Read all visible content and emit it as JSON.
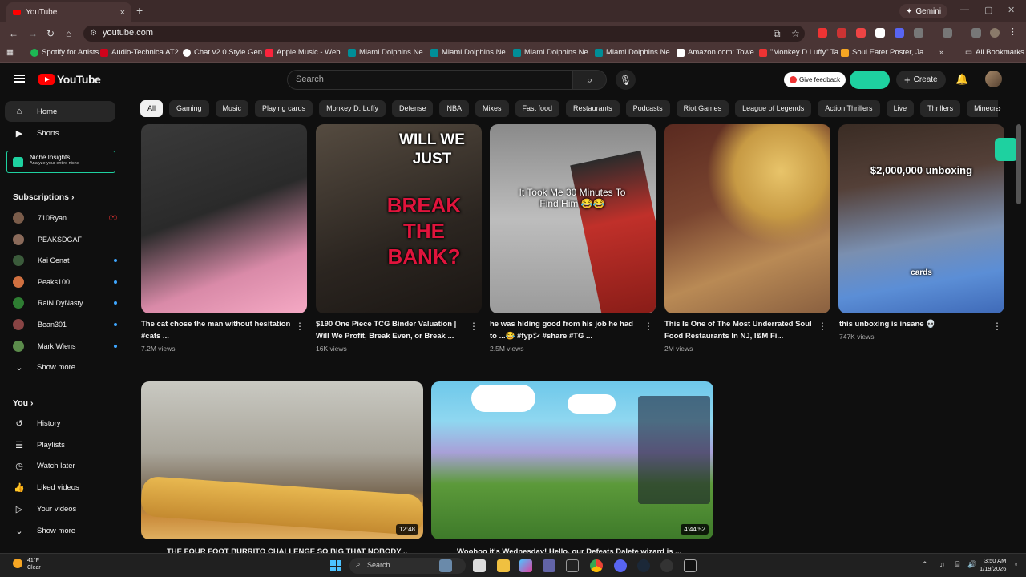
{
  "browser": {
    "tab_title": "YouTube",
    "tab_close": "×",
    "new_tab": "+",
    "gemini_label": "Gemini",
    "url": "youtube.com",
    "bookmarks": [
      {
        "label": "Spotify for Artists",
        "color": "#1db954"
      },
      {
        "label": "Audio-Technica AT2...",
        "color": "#d0021b"
      },
      {
        "label": "Chat v2.0 Style Gen...",
        "color": "#ffffff"
      },
      {
        "label": "Apple Music - Web...",
        "color": "#fa243c"
      },
      {
        "label": "Miami Dolphins Ne...",
        "color": "#008e97"
      },
      {
        "label": "Miami Dolphins Ne...",
        "color": "#008e97"
      },
      {
        "label": "Miami Dolphins Ne...",
        "color": "#008e97"
      },
      {
        "label": "Miami Dolphins Ne...",
        "color": "#008e97"
      },
      {
        "label": "Amazon.com: Towe...",
        "color": "#ffffff"
      },
      {
        "label": "\"Monkey D Luffy\" Ta...",
        "color": "#e33"
      },
      {
        "label": "Soul Eater Poster, Ja...",
        "color": "#f5a623"
      }
    ],
    "all_bookmarks": "All Bookmarks"
  },
  "header": {
    "logo_text": "YouTube",
    "search_placeholder": "Search",
    "feedback_label": "Give feedback",
    "create_label": "Create"
  },
  "sidebar": {
    "home": "Home",
    "shorts": "Shorts",
    "niche_title": "Niche Insights",
    "niche_sub": "Analyze your entire niche",
    "subscriptions_label": "Subscriptions",
    "subscriptions": [
      {
        "name": "710Ryan",
        "color": "#7a5c4a",
        "status": "live"
      },
      {
        "name": "PEAKSDGAF",
        "color": "#8a6a5a",
        "status": "none"
      },
      {
        "name": "Kai Cenat",
        "color": "#3b5b3b",
        "status": "dot"
      },
      {
        "name": "Peaks100",
        "color": "#d07040",
        "status": "dot"
      },
      {
        "name": "RaiN DyNasty",
        "color": "#2e7d32",
        "status": "dot"
      },
      {
        "name": "Bean301",
        "color": "#884444",
        "status": "dot"
      },
      {
        "name": "Mark Wiens",
        "color": "#5b8b4b",
        "status": "dot"
      }
    ],
    "show_more_1": "Show more",
    "you_label": "You",
    "you_items": [
      "History",
      "Playlists",
      "Watch later",
      "Liked videos",
      "Your videos"
    ],
    "show_more_2": "Show more"
  },
  "chips": [
    "All",
    "Gaming",
    "Music",
    "Playing cards",
    "Monkey D. Luffy",
    "Defense",
    "NBA",
    "Mixes",
    "Fast food",
    "Restaurants",
    "Podcasts",
    "Riot Games",
    "League of Legends",
    "Action Thrillers",
    "Live",
    "Thrillers",
    "Minecra"
  ],
  "shorts": [
    {
      "title": "The cat chose the man without hesitation #cats ...",
      "views": "7.2M views",
      "overlay": ""
    },
    {
      "title": "$190 One Piece TCG Binder Valuation | Will We Profit, Break Even, or Break ...",
      "views": "16K views",
      "overlay_top": "WILL WE JUST",
      "overlay_red": "BREAK THE BANK?"
    },
    {
      "title": "he was hiding good from his job he had to ...😂 #fypシ #share #TG ...",
      "views": "2.5M views",
      "overlay_top": "It Took Me 30 Minutes To Find Him 😂😂"
    },
    {
      "title": "This Is One of The Most Underrated Soul Food Restaurants In NJ, I&M Fi...",
      "views": "2M views"
    },
    {
      "title": "this unboxing is insane 💀",
      "views": "747K views",
      "overlay_top": "$2,000,000 unboxing",
      "overlay_mid": "cards"
    }
  ],
  "videos": [
    {
      "title": "THE FOUR FOOT BURRITO CHALLENGE SO BIG THAT NOBODY ...",
      "duration": "12:48"
    },
    {
      "title": "Woohoo it's Wednesday! Hello, our Defeats Dalete wizard is ...",
      "duration": "4:44:52"
    }
  ],
  "taskbar": {
    "temp": "41°F",
    "weather": "Clear",
    "search": "Search",
    "time": "3:50 AM",
    "date": "1/19/2026"
  }
}
